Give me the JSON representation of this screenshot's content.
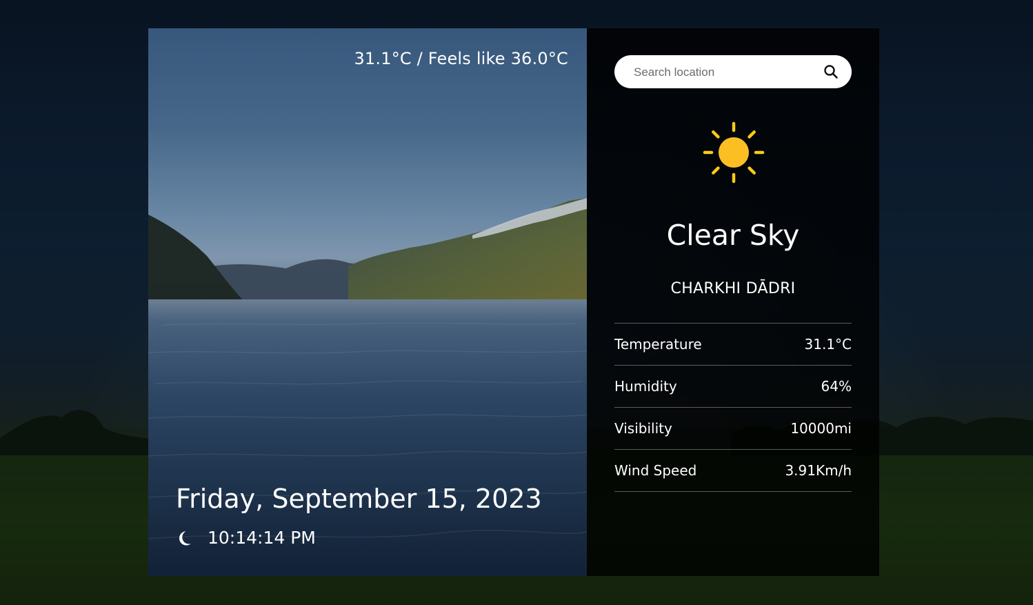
{
  "colors": {
    "sun": "#fbbf24",
    "sun_rays": "#facc15",
    "panel_bg": "#000000",
    "text": "#ffffff"
  },
  "header": {
    "temp_feels": "31.1°C / Feels like 36.0°C"
  },
  "datetime": {
    "date": "Friday, September 15, 2023",
    "time": "10:14:14 PM",
    "time_icon": "moon-icon"
  },
  "search": {
    "placeholder": "Search location",
    "value": "",
    "icon": "search-icon"
  },
  "weather": {
    "icon": "sun-icon",
    "condition": "Clear Sky",
    "location": "CHARKHI DĀDRI"
  },
  "stats": [
    {
      "label": "Temperature",
      "value": "31.1°C"
    },
    {
      "label": "Humidity",
      "value": "64%"
    },
    {
      "label": "Visibility",
      "value": "10000mi"
    },
    {
      "label": "Wind Speed",
      "value": "3.91Km/h"
    }
  ]
}
